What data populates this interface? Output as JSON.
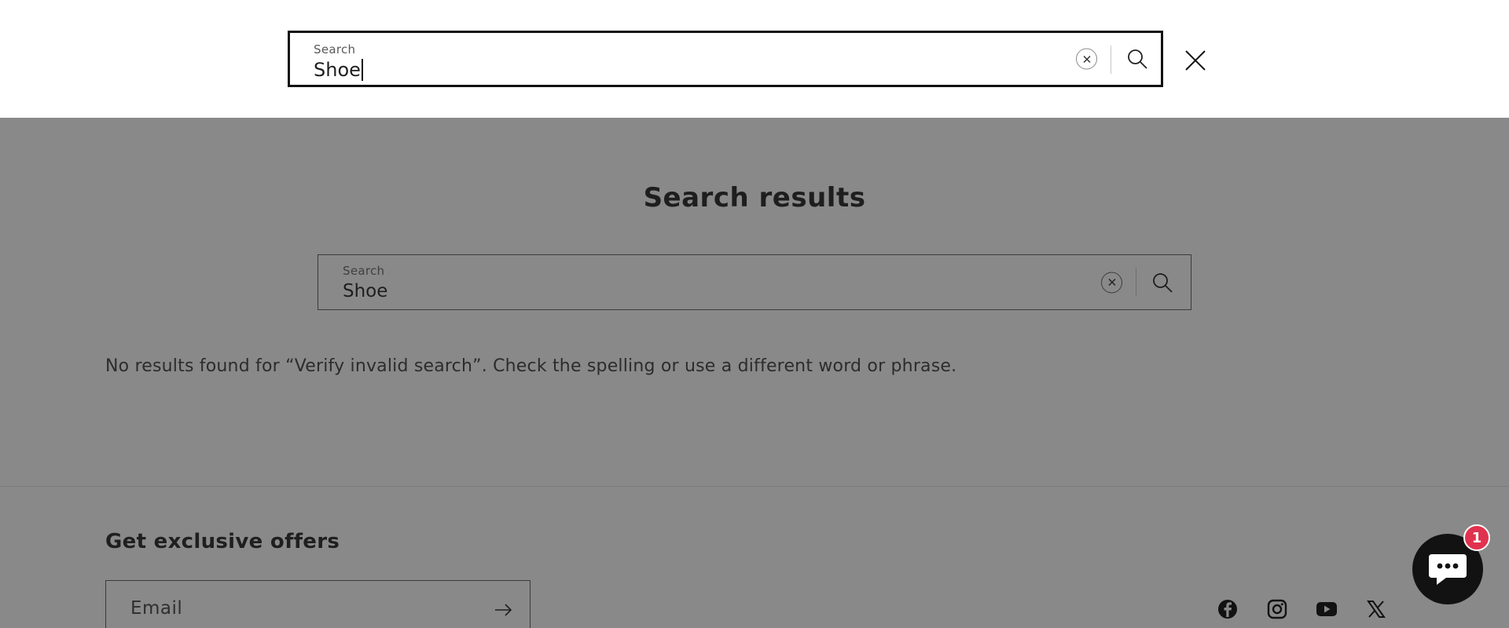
{
  "search_overlay": {
    "label": "Search",
    "value": "Shoe",
    "reset_icon": "close-circle-icon",
    "submit_icon": "search-icon",
    "close_icon": "close-icon"
  },
  "main": {
    "title": "Search results",
    "search": {
      "label": "Search",
      "value": "Shoe"
    },
    "no_results_text": "No results found for “Verify invalid search”. Check the spelling or use a different word or phrase."
  },
  "footer": {
    "newsletter_title": "Get exclusive offers",
    "email_placeholder": "Email",
    "socials": [
      "facebook-icon",
      "instagram-icon",
      "youtube-icon",
      "x-icon"
    ]
  },
  "chat": {
    "badge_count": "1"
  },
  "colors": {
    "overlay_bg": "#898989",
    "badge": "#e0324e",
    "chat_bg": "#121212"
  }
}
